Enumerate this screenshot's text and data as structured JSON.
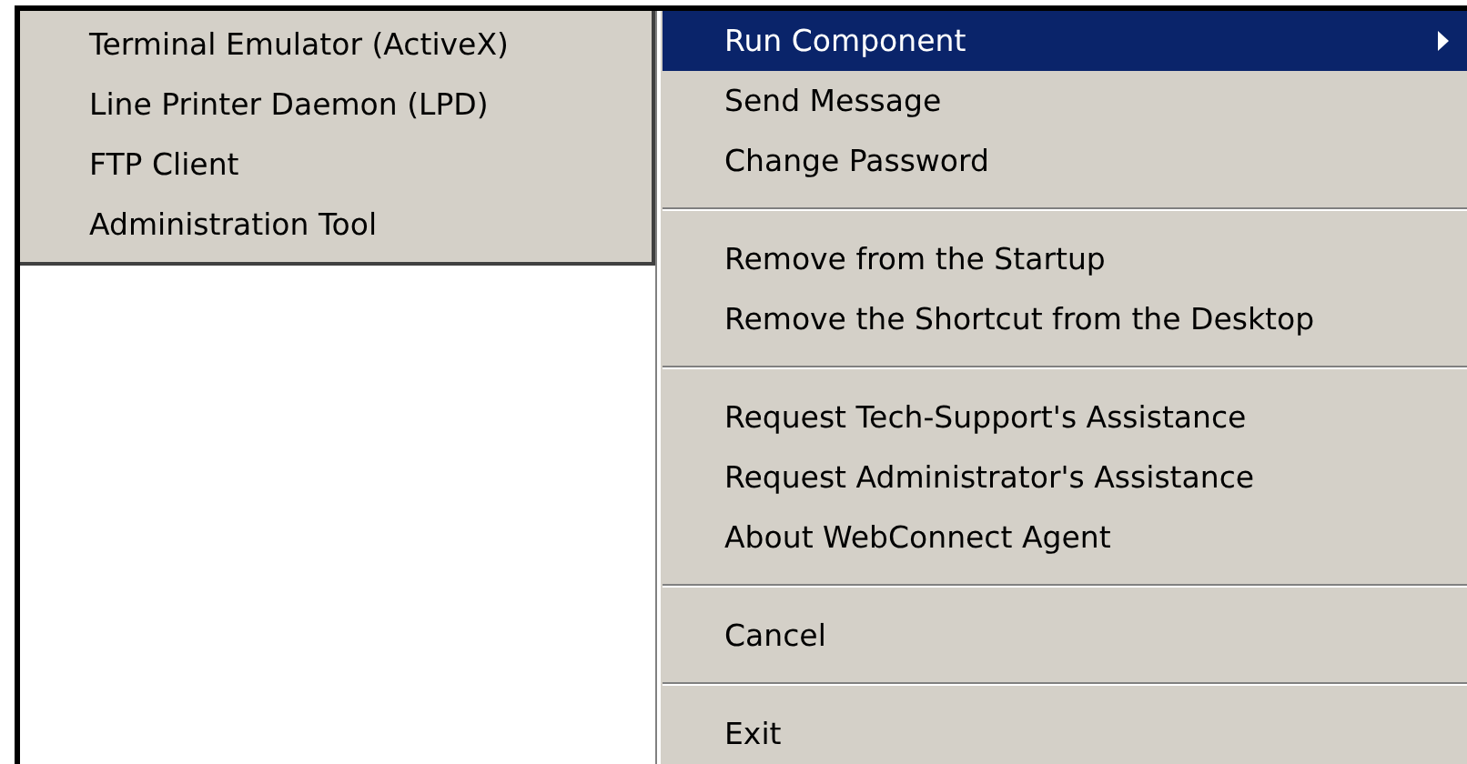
{
  "submenu": {
    "items": [
      {
        "label": "Terminal Emulator (ActiveX)",
        "selected": false
      },
      {
        "label": "Line Printer Daemon (LPD)",
        "selected": false
      },
      {
        "label": "FTP Client",
        "selected": false
      },
      {
        "label": "Administration Tool",
        "selected": false
      }
    ]
  },
  "menu": {
    "items": [
      {
        "kind": "item",
        "label": "Run Component",
        "selected": true,
        "has_submenu": true
      },
      {
        "kind": "item",
        "label": "Send Message",
        "selected": false
      },
      {
        "kind": "item",
        "label": "Change Password",
        "selected": false
      },
      {
        "kind": "separator"
      },
      {
        "kind": "item",
        "label": "Remove from the Startup",
        "selected": false
      },
      {
        "kind": "item",
        "label": "Remove the Shortcut from the Desktop",
        "selected": false
      },
      {
        "kind": "separator"
      },
      {
        "kind": "item",
        "label": "Request Tech-Support's Assistance",
        "selected": false
      },
      {
        "kind": "item",
        "label": "Request Administrator's Assistance",
        "selected": false
      },
      {
        "kind": "item",
        "label": "About WebConnect Agent",
        "selected": false
      },
      {
        "kind": "separator"
      },
      {
        "kind": "item",
        "label": "Cancel",
        "selected": false
      },
      {
        "kind": "separator"
      },
      {
        "kind": "item",
        "label": "Exit",
        "selected": false
      }
    ]
  }
}
